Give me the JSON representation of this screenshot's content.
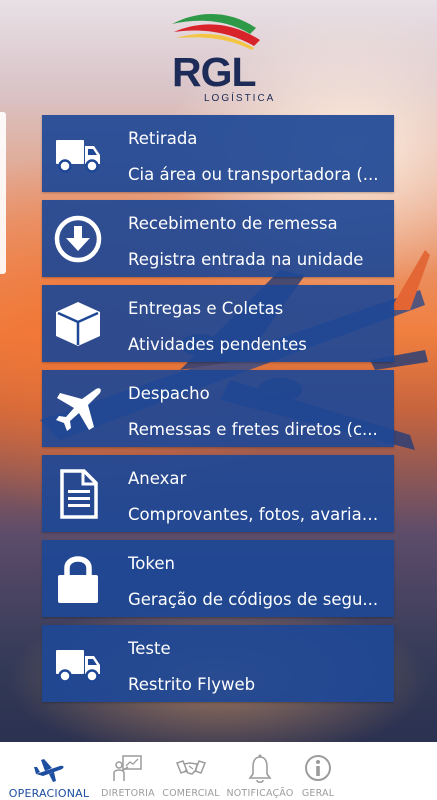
{
  "brand": {
    "name": "RGL",
    "subtitle": "LOGÍSTICA"
  },
  "menu": [
    {
      "title": "Retirada",
      "subtitle": "Cia área ou transportadora (...",
      "icon": "truck-icon"
    },
    {
      "title": "Recebimento de remessa",
      "subtitle": "Registra entrada na unidade",
      "icon": "download-circle-icon"
    },
    {
      "title": "Entregas e Coletas",
      "subtitle": "Atividades pendentes",
      "icon": "box-icon"
    },
    {
      "title": "Despacho",
      "subtitle": "Remessas e fretes diretos (c...",
      "icon": "airplane-icon"
    },
    {
      "title": "Anexar",
      "subtitle": "Comprovantes, fotos, avarias...",
      "icon": "document-icon"
    },
    {
      "title": "Token",
      "subtitle": "Geração de códigos de segu...",
      "icon": "lock-icon"
    },
    {
      "title": "Teste",
      "subtitle": "Restrito Flyweb",
      "icon": "truck-icon"
    }
  ],
  "tabs": [
    {
      "label": "OPERACIONAL",
      "icon": "airplane-icon",
      "active": true
    },
    {
      "label": "DIRETORIA",
      "icon": "presentation-icon",
      "active": false
    },
    {
      "label": "COMERCIAL",
      "icon": "handshake-icon",
      "active": false
    },
    {
      "label": "NOTIFICAÇÃO",
      "icon": "bell-icon",
      "active": false
    },
    {
      "label": "GERAL",
      "icon": "info-icon",
      "active": false
    }
  ],
  "colors": {
    "card": "#1e4896",
    "brand_navy": "#1c2b57",
    "active_tab": "#1d4ea0",
    "inactive_tab": "#9c9c9c",
    "logo_green": "#2e9a48",
    "logo_red": "#d8232a"
  }
}
